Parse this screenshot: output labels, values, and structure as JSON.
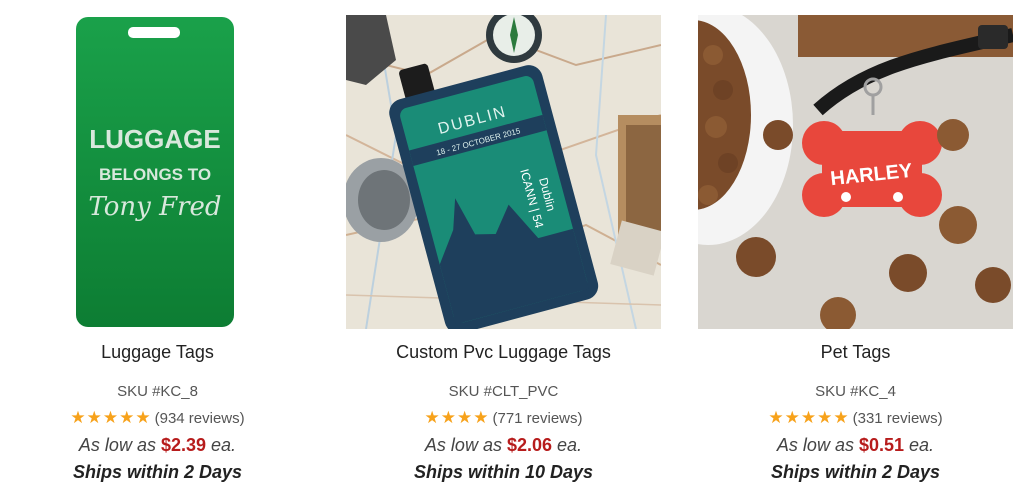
{
  "colors": {
    "star": "#f7a21b",
    "price": "#b71c1c"
  },
  "products": [
    {
      "name": "Luggage Tags",
      "sku": "SKU #KC_8",
      "rating": 5,
      "reviews": "(934 reviews)",
      "price_prefix": "As low as",
      "price": "$2.39",
      "price_suffix": "ea.",
      "ships": "Ships within 2 Days",
      "image_text": [
        "LUGGAGE",
        "BELONGS TO",
        "Tony Fred"
      ]
    },
    {
      "name": "Custom Pvc Luggage Tags",
      "sku": "SKU #CLT_PVC",
      "rating": 4,
      "reviews": "(771 reviews)",
      "price_prefix": "As low as",
      "price": "$2.06",
      "price_suffix": "ea.",
      "ships": "Ships within 10 Days",
      "image_text": [
        "DUBLIN",
        "18 - 27 OCTOBER 2015",
        "ICANN | 54",
        "Dublin"
      ]
    },
    {
      "name": "Pet Tags",
      "sku": "SKU #KC_4",
      "rating": 5,
      "reviews": "(331 reviews)",
      "price_prefix": "As low as",
      "price": "$0.51",
      "price_suffix": "ea.",
      "ships": "Ships within 2 Days",
      "image_text": [
        "HARLEY"
      ]
    }
  ]
}
